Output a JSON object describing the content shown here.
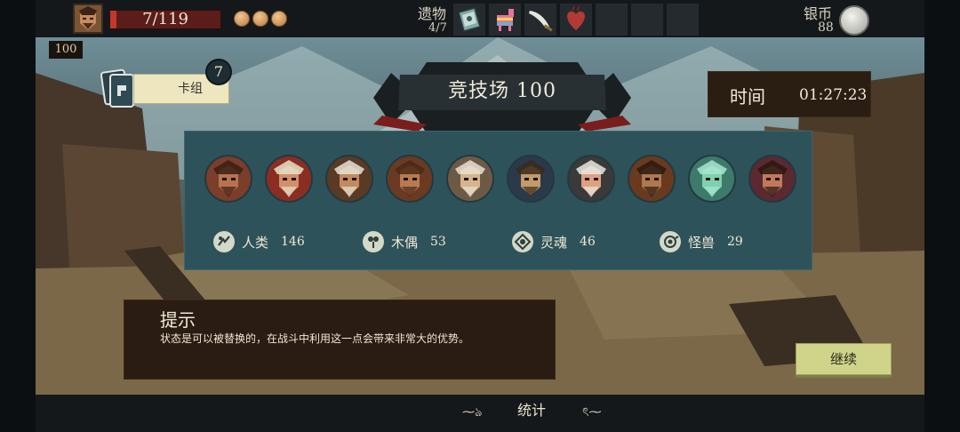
{
  "hud": {
    "health_text": "7/119",
    "health_fraction": 0.06,
    "coins": 3,
    "relics_label": "遗物",
    "relics_count": "4/7",
    "relic_icons": [
      "book-icon",
      "pinata-icon",
      "cutlass-icon",
      "heart-icon"
    ],
    "empty_relic_slots": 3,
    "silver_label": "银币",
    "silver_value": "88"
  },
  "level_badge": "100",
  "deck": {
    "label": "卡组",
    "count": "7"
  },
  "arena": {
    "title": "竞技场",
    "level": "100"
  },
  "timer": {
    "label": "时间",
    "value": "01:27:23"
  },
  "enemies": [
    "eyepatch-pirate",
    "feathered-captain",
    "bearded-buccaneer",
    "tricorn-pirate",
    "horned-elder",
    "long-haired-pirate",
    "hat-captain",
    "masked-bandit",
    "ghost-spirit",
    "horned-woman"
  ],
  "stats": [
    {
      "id": "human",
      "label": "人类",
      "value": "146",
      "icon": "human-icon"
    },
    {
      "id": "puppet",
      "label": "木偶",
      "value": "53",
      "icon": "puppet-icon"
    },
    {
      "id": "spirit",
      "label": "灵魂",
      "value": "46",
      "icon": "spirit-icon"
    },
    {
      "id": "beast",
      "label": "怪兽",
      "value": "29",
      "icon": "beast-icon"
    }
  ],
  "tip": {
    "title": "提示",
    "body": "状态是可以被替换的，在战斗中利用这一点会带来非常大的优势。"
  },
  "continue_label": "继续",
  "bottom": {
    "stats_label": "统计"
  },
  "colors": {
    "panel": "#2e525a",
    "tip_bg": "#2a1c12",
    "continue_bg": "#cfd48a",
    "health": "#c0392b"
  }
}
